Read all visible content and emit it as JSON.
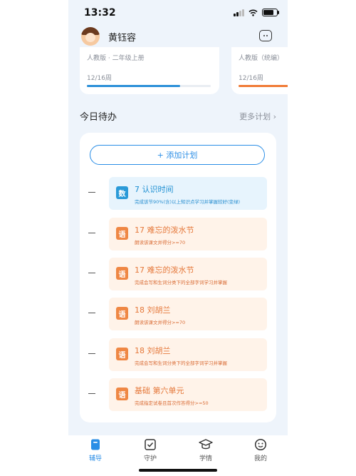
{
  "status_bar": {
    "time": "13:32"
  },
  "header": {
    "user_name": "黄钰容"
  },
  "books": [
    {
      "subtitle": "人教版 · 二年级上册",
      "week": "12/16周",
      "progress": 0.75,
      "color": "#2a8fd8"
    },
    {
      "subtitle": "人教版（统编）",
      "week": "12/16周",
      "progress": 0.75,
      "color": "#f07a35"
    }
  ],
  "todo": {
    "title": "今日待办",
    "more_label": "更多计划 ›",
    "add_label": "+ 添加计划",
    "items": [
      {
        "badge": "数",
        "subject": "math",
        "title": "7 认识时间",
        "desc": "完成该节90%(含)以上知识点学习并掌握较好(变绿)"
      },
      {
        "badge": "语",
        "subject": "chinese",
        "title": "17 难忘的泼水节",
        "desc": "朗读该课文并得分>=70"
      },
      {
        "badge": "语",
        "subject": "chinese",
        "title": "17 难忘的泼水节",
        "desc": "完成会写和生词分类下的全部字词学习并掌握"
      },
      {
        "badge": "语",
        "subject": "chinese",
        "title": "18 刘胡兰",
        "desc": "朗读该课文并得分>=70"
      },
      {
        "badge": "语",
        "subject": "chinese",
        "title": "18 刘胡兰",
        "desc": "完成会写和生词分类下的全部字词学习并掌握"
      },
      {
        "badge": "语",
        "subject": "chinese",
        "title": "基础 第六单元",
        "desc": "完成指定试卷且首次作答得分>=50"
      }
    ]
  },
  "tabs": [
    {
      "label": "辅导",
      "icon": "book-icon",
      "active": true
    },
    {
      "label": "守护",
      "icon": "shield-check-icon",
      "active": false
    },
    {
      "label": "学情",
      "icon": "graduation-cap-icon",
      "active": false
    },
    {
      "label": "我的",
      "icon": "smiley-icon",
      "active": false
    }
  ],
  "colors": {
    "accent": "#2b8ee6",
    "math": "#2a9ad8",
    "chinese": "#ef8744"
  }
}
